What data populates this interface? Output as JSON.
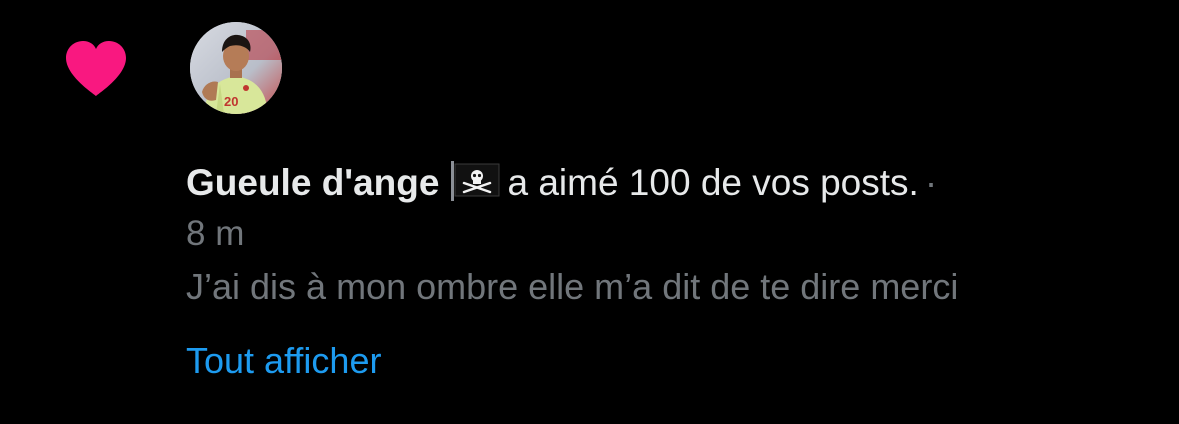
{
  "notification": {
    "icon": "heart-icon",
    "icon_color": "#f91880",
    "avatar": "user-avatar-footballer",
    "user_name": "Gueule d'ange",
    "user_emoji": "pirate-flag-icon",
    "action_text": "a aimé 100 de vos posts.",
    "separator": "·",
    "timestamp": "8 m",
    "post_excerpt": "J’ai dis à mon ombre elle m’a dit de te dire merci",
    "show_all_label": "Tout afficher",
    "link_color": "#1d9bf0",
    "muted_color": "#71767b"
  }
}
